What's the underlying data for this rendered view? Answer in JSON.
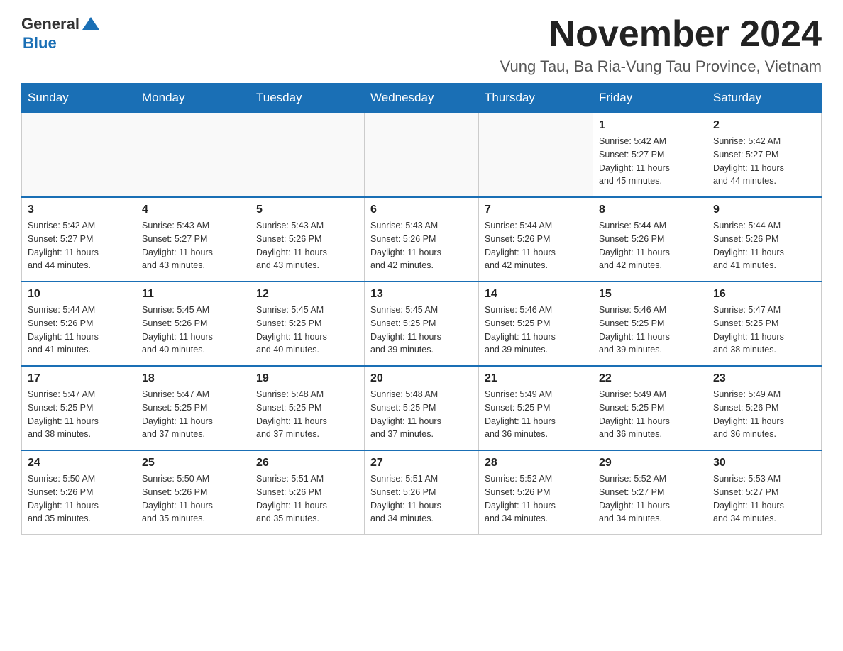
{
  "logo": {
    "text_general": "General",
    "text_blue": "Blue",
    "icon_shape": "triangle"
  },
  "header": {
    "title": "November 2024",
    "subtitle": "Vung Tau, Ba Ria-Vung Tau Province, Vietnam"
  },
  "days_of_week": [
    "Sunday",
    "Monday",
    "Tuesday",
    "Wednesday",
    "Thursday",
    "Friday",
    "Saturday"
  ],
  "weeks": [
    {
      "cells": [
        {
          "day": "",
          "info": ""
        },
        {
          "day": "",
          "info": ""
        },
        {
          "day": "",
          "info": ""
        },
        {
          "day": "",
          "info": ""
        },
        {
          "day": "",
          "info": ""
        },
        {
          "day": "1",
          "info": "Sunrise: 5:42 AM\nSunset: 5:27 PM\nDaylight: 11 hours\nand 45 minutes."
        },
        {
          "day": "2",
          "info": "Sunrise: 5:42 AM\nSunset: 5:27 PM\nDaylight: 11 hours\nand 44 minutes."
        }
      ]
    },
    {
      "cells": [
        {
          "day": "3",
          "info": "Sunrise: 5:42 AM\nSunset: 5:27 PM\nDaylight: 11 hours\nand 44 minutes."
        },
        {
          "day": "4",
          "info": "Sunrise: 5:43 AM\nSunset: 5:27 PM\nDaylight: 11 hours\nand 43 minutes."
        },
        {
          "day": "5",
          "info": "Sunrise: 5:43 AM\nSunset: 5:26 PM\nDaylight: 11 hours\nand 43 minutes."
        },
        {
          "day": "6",
          "info": "Sunrise: 5:43 AM\nSunset: 5:26 PM\nDaylight: 11 hours\nand 42 minutes."
        },
        {
          "day": "7",
          "info": "Sunrise: 5:44 AM\nSunset: 5:26 PM\nDaylight: 11 hours\nand 42 minutes."
        },
        {
          "day": "8",
          "info": "Sunrise: 5:44 AM\nSunset: 5:26 PM\nDaylight: 11 hours\nand 42 minutes."
        },
        {
          "day": "9",
          "info": "Sunrise: 5:44 AM\nSunset: 5:26 PM\nDaylight: 11 hours\nand 41 minutes."
        }
      ]
    },
    {
      "cells": [
        {
          "day": "10",
          "info": "Sunrise: 5:44 AM\nSunset: 5:26 PM\nDaylight: 11 hours\nand 41 minutes."
        },
        {
          "day": "11",
          "info": "Sunrise: 5:45 AM\nSunset: 5:26 PM\nDaylight: 11 hours\nand 40 minutes."
        },
        {
          "day": "12",
          "info": "Sunrise: 5:45 AM\nSunset: 5:25 PM\nDaylight: 11 hours\nand 40 minutes."
        },
        {
          "day": "13",
          "info": "Sunrise: 5:45 AM\nSunset: 5:25 PM\nDaylight: 11 hours\nand 39 minutes."
        },
        {
          "day": "14",
          "info": "Sunrise: 5:46 AM\nSunset: 5:25 PM\nDaylight: 11 hours\nand 39 minutes."
        },
        {
          "day": "15",
          "info": "Sunrise: 5:46 AM\nSunset: 5:25 PM\nDaylight: 11 hours\nand 39 minutes."
        },
        {
          "day": "16",
          "info": "Sunrise: 5:47 AM\nSunset: 5:25 PM\nDaylight: 11 hours\nand 38 minutes."
        }
      ]
    },
    {
      "cells": [
        {
          "day": "17",
          "info": "Sunrise: 5:47 AM\nSunset: 5:25 PM\nDaylight: 11 hours\nand 38 minutes."
        },
        {
          "day": "18",
          "info": "Sunrise: 5:47 AM\nSunset: 5:25 PM\nDaylight: 11 hours\nand 37 minutes."
        },
        {
          "day": "19",
          "info": "Sunrise: 5:48 AM\nSunset: 5:25 PM\nDaylight: 11 hours\nand 37 minutes."
        },
        {
          "day": "20",
          "info": "Sunrise: 5:48 AM\nSunset: 5:25 PM\nDaylight: 11 hours\nand 37 minutes."
        },
        {
          "day": "21",
          "info": "Sunrise: 5:49 AM\nSunset: 5:25 PM\nDaylight: 11 hours\nand 36 minutes."
        },
        {
          "day": "22",
          "info": "Sunrise: 5:49 AM\nSunset: 5:25 PM\nDaylight: 11 hours\nand 36 minutes."
        },
        {
          "day": "23",
          "info": "Sunrise: 5:49 AM\nSunset: 5:26 PM\nDaylight: 11 hours\nand 36 minutes."
        }
      ]
    },
    {
      "cells": [
        {
          "day": "24",
          "info": "Sunrise: 5:50 AM\nSunset: 5:26 PM\nDaylight: 11 hours\nand 35 minutes."
        },
        {
          "day": "25",
          "info": "Sunrise: 5:50 AM\nSunset: 5:26 PM\nDaylight: 11 hours\nand 35 minutes."
        },
        {
          "day": "26",
          "info": "Sunrise: 5:51 AM\nSunset: 5:26 PM\nDaylight: 11 hours\nand 35 minutes."
        },
        {
          "day": "27",
          "info": "Sunrise: 5:51 AM\nSunset: 5:26 PM\nDaylight: 11 hours\nand 34 minutes."
        },
        {
          "day": "28",
          "info": "Sunrise: 5:52 AM\nSunset: 5:26 PM\nDaylight: 11 hours\nand 34 minutes."
        },
        {
          "day": "29",
          "info": "Sunrise: 5:52 AM\nSunset: 5:27 PM\nDaylight: 11 hours\nand 34 minutes."
        },
        {
          "day": "30",
          "info": "Sunrise: 5:53 AM\nSunset: 5:27 PM\nDaylight: 11 hours\nand 34 minutes."
        }
      ]
    }
  ],
  "accent_color": "#1a6fb5"
}
